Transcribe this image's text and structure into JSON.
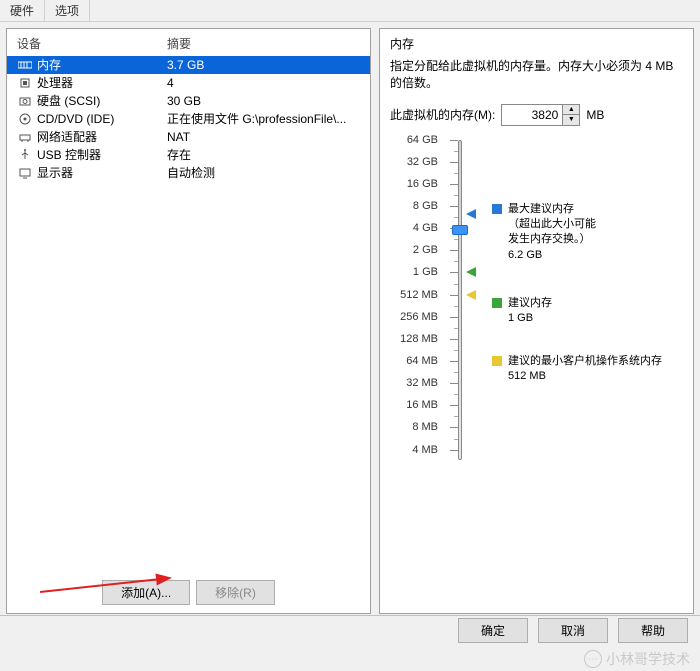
{
  "tabs": {
    "t0": "硬件",
    "t1": "选项"
  },
  "dev_header": {
    "device": "设备",
    "summary": "摘要"
  },
  "devices": [
    {
      "name": "内存",
      "summary": "3.7 GB"
    },
    {
      "name": "处理器",
      "summary": "4"
    },
    {
      "name": "硬盘 (SCSI)",
      "summary": "30 GB"
    },
    {
      "name": "CD/DVD (IDE)",
      "summary": "正在使用文件 G:\\professionFile\\..."
    },
    {
      "name": "网络适配器",
      "summary": "NAT"
    },
    {
      "name": "USB 控制器",
      "summary": "存在"
    },
    {
      "name": "显示器",
      "summary": "自动检测"
    }
  ],
  "left_buttons": {
    "add": "添加(A)...",
    "remove": "移除(R)"
  },
  "right": {
    "title": "内存",
    "desc": "指定分配给此虚拟机的内存量。内存大小必须为 4 MB 的倍数。",
    "mem_label": "此虚拟机的内存(M):",
    "mem_value": "3820",
    "mem_unit": "MB",
    "ticks": [
      "64 GB",
      "32 GB",
      "16 GB",
      "8 GB",
      "4 GB",
      "2 GB",
      "1 GB",
      "512 MB",
      "256 MB",
      "128 MB",
      "64 MB",
      "32 MB",
      "16 MB",
      "8 MB",
      "4 MB"
    ],
    "legend": {
      "max_title": "最大建议内存",
      "max_note": "（超出此大小可能\n发生内存交换。）",
      "max_val": "6.2 GB",
      "rec_title": "建议内存",
      "rec_val": "1 GB",
      "min_title": "建议的最小客户机操作系统内存",
      "min_val": "512 MB"
    }
  },
  "bottom": {
    "ok": "确定",
    "cancel": "取消",
    "help": "帮助"
  },
  "watermark": "小林哥学技术"
}
